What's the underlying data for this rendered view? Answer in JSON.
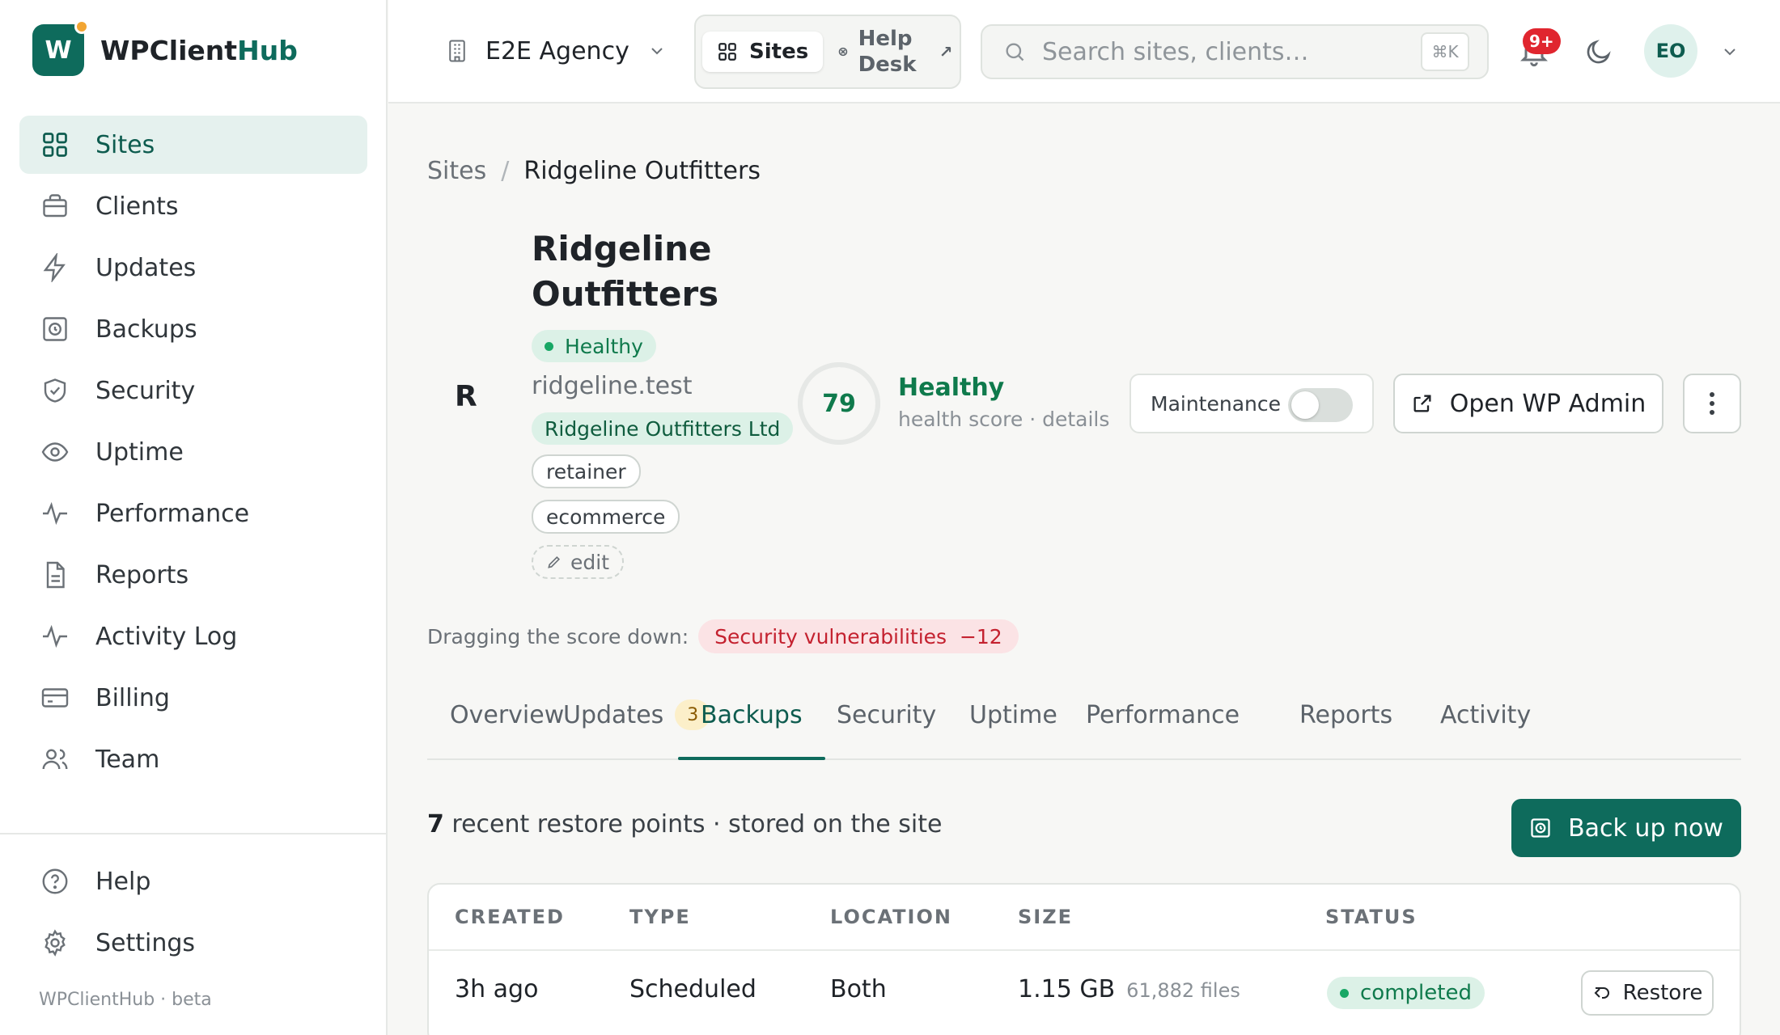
{
  "app": {
    "logo_letter": "W",
    "name_part1": "WPClient",
    "name_part2": "Hub",
    "footer": "WPClientHub · beta"
  },
  "sidebar": {
    "items": [
      {
        "label": "Sites",
        "icon": "grid-icon",
        "active": true
      },
      {
        "label": "Clients",
        "icon": "briefcase-icon"
      },
      {
        "label": "Updates",
        "icon": "bolt-icon"
      },
      {
        "label": "Backups",
        "icon": "backup-icon"
      },
      {
        "label": "Security",
        "icon": "shield-icon"
      },
      {
        "label": "Uptime",
        "icon": "eye-icon"
      },
      {
        "label": "Performance",
        "icon": "pulse-icon"
      },
      {
        "label": "Reports",
        "icon": "document-icon"
      },
      {
        "label": "Activity Log",
        "icon": "pulse-icon"
      },
      {
        "label": "Billing",
        "icon": "card-icon"
      },
      {
        "label": "Team",
        "icon": "users-icon"
      }
    ],
    "bottom": [
      {
        "label": "Help",
        "icon": "help-icon"
      },
      {
        "label": "Settings",
        "icon": "gear-icon"
      }
    ]
  },
  "topbar": {
    "agency": "E2E Agency",
    "switcher_sites": "Sites",
    "switcher_help_line1": "Help",
    "switcher_help_line2": "Desk",
    "search_placeholder": "Search sites, clients…",
    "search_shortcut": "⌘K",
    "notifications_badge": "9+",
    "avatar_initials": "EO"
  },
  "breadcrumb": {
    "root": "Sites",
    "current": "Ridgeline Outfitters"
  },
  "site": {
    "initial": "R",
    "title": "Ridgeline Outfitters",
    "status": "Healthy",
    "domain": "ridgeline.test",
    "client": "Ridgeline Outfitters Ltd",
    "tags": [
      "retainer",
      "ecommerce"
    ],
    "edit_label": "edit",
    "score": 79,
    "score_label": "Healthy",
    "score_sub": "health score · details",
    "maintenance_label": "Maintenance",
    "maintenance_on": false,
    "open_admin": "Open WP Admin",
    "drag_label": "Dragging the score down:",
    "drag_item": "Security vulnerabilities  −12"
  },
  "tabs": [
    {
      "label": "Overview"
    },
    {
      "label": "Updates",
      "count": "3"
    },
    {
      "label": "Backups",
      "active": true
    },
    {
      "label": "Security"
    },
    {
      "label": "Uptime"
    },
    {
      "label": "Performance"
    },
    {
      "label": "Reports"
    },
    {
      "label": "Activity"
    }
  ],
  "backups": {
    "count": "7",
    "summary": " recent restore points · stored on the site",
    "backup_now": "Back up now",
    "columns": [
      "CREATED",
      "TYPE",
      "LOCATION",
      "SIZE",
      "STATUS"
    ],
    "rows": [
      {
        "created": "3h ago",
        "type": "Scheduled",
        "location": "Both",
        "size": "1.15 GB",
        "files": "61,882 files",
        "status": "completed",
        "action": "Restore"
      }
    ]
  },
  "colors": {
    "brand": "#0e6b5c",
    "success": "#18a765",
    "danger": "#c4212f",
    "badge": "#e0262f"
  }
}
